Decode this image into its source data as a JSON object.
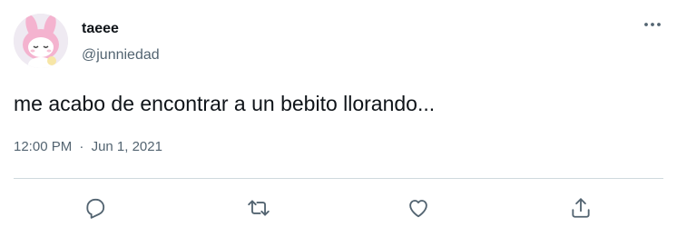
{
  "tweet": {
    "display_name": "taeee",
    "handle": "@junniedad",
    "text": "me acabo de encontrar a un bebito llorando...",
    "time": "12:00 PM",
    "separator": "·",
    "date": "Jun 1, 2021"
  },
  "icons": {
    "more": "more-horizontal-icon",
    "reply": "reply-icon",
    "retweet": "retweet-icon",
    "like": "heart-icon",
    "share": "share-icon"
  },
  "colors": {
    "icon": "#536471",
    "divider": "#cfd9de",
    "secondary_text": "#536471",
    "primary_text": "#0f1419"
  }
}
